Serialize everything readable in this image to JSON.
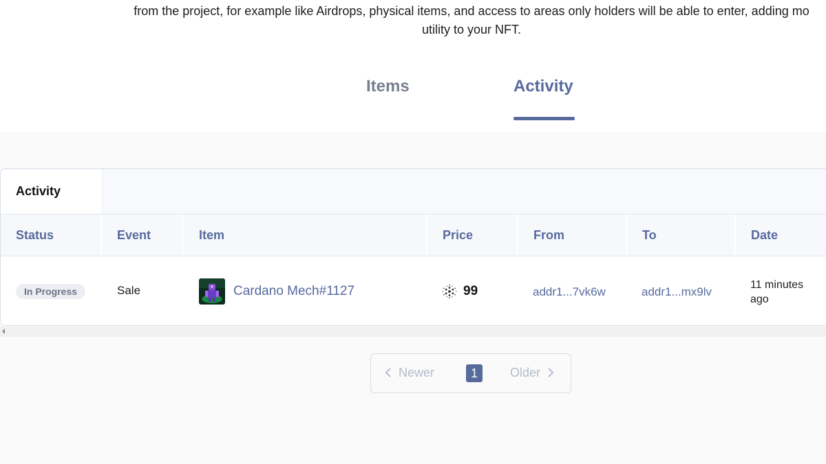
{
  "description": {
    "line1": "from the project, for example like Airdrops, physical items, and access to areas only holders will be able to enter, adding mo",
    "line2": "utility to your NFT."
  },
  "tabs": [
    {
      "label": "Items",
      "active": false
    },
    {
      "label": "Activity",
      "active": true
    }
  ],
  "colors": {
    "accent": "#566a9c",
    "tab_inactive": "#778090",
    "badge_bg": "#eceef2"
  },
  "activity_panel": {
    "tab_label": "Activity",
    "columns": [
      "Status",
      "Event",
      "Item",
      "Price",
      "From",
      "To",
      "Date"
    ],
    "rows": [
      {
        "status": "In Progress",
        "event": "Sale",
        "item": "Cardano Mech#1127",
        "item_icon": "nft-thumbnail",
        "price_icon": "cardano-icon",
        "price": "99",
        "from": "addr1...7vk6w",
        "to": "addr1...mx9lv",
        "date": "11 minutes ago"
      }
    ]
  },
  "pagination": {
    "newer_label": "Newer",
    "older_label": "Older",
    "current_page": "1"
  }
}
